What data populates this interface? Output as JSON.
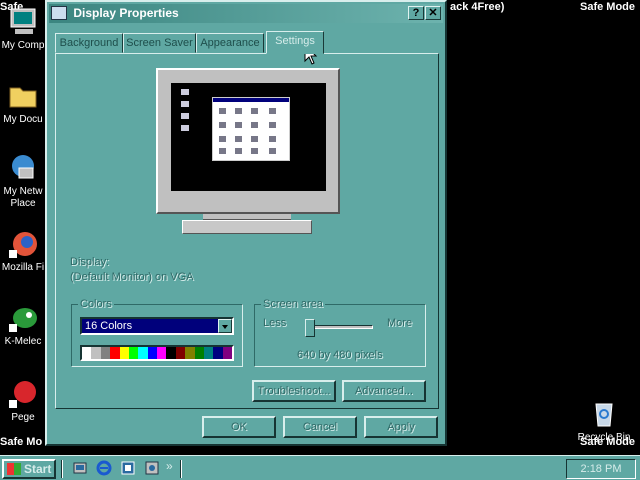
{
  "desktop": {
    "safe_mode_label": "Safe Mode",
    "safe_mode_left": "Safe",
    "header_fragment": "ack 4Free)",
    "icons": [
      {
        "label": "My Comp",
        "icon": "computer-icon"
      },
      {
        "label": "My Docu",
        "icon": "folder-icon"
      },
      {
        "label": "My Netw Place",
        "icon": "network-icon"
      },
      {
        "label": "Mozilla Fi",
        "icon": "firefox-icon"
      },
      {
        "label": "K-Melec",
        "icon": "kmeleon-icon"
      },
      {
        "label": "Pege",
        "icon": "app-icon"
      },
      {
        "label": "Safe Mo",
        "icon": ""
      },
      {
        "label": "Recycle Bin",
        "icon": "recycle-bin-icon"
      }
    ]
  },
  "dialog": {
    "title": "Display Properties",
    "help_glyph": "?",
    "close_glyph": "✕",
    "tabs": [
      {
        "label": "Background",
        "active": false
      },
      {
        "label": "Screen Saver",
        "active": false
      },
      {
        "label": "Appearance",
        "active": false
      },
      {
        "label": "Settings",
        "active": true
      }
    ],
    "display_label": "Display:",
    "display_value": "(Default Monitor) on VGA",
    "colors": {
      "group_label": "Colors",
      "selected": "16 Colors",
      "swatches": [
        "#ffffff",
        "#c0c0c0",
        "#808080",
        "#ff0000",
        "#ffff00",
        "#00ff00",
        "#00ffff",
        "#0000ff",
        "#ff00ff",
        "#000000",
        "#800000",
        "#808000",
        "#008000",
        "#008080",
        "#000080",
        "#800080"
      ]
    },
    "screen_area": {
      "group_label": "Screen area",
      "less": "Less",
      "more": "More",
      "resolution": "640 by 480 pixels",
      "level": 0
    },
    "buttons": {
      "troubleshoot": "Troubleshoot...",
      "advanced": "Advanced...",
      "ok": "OK",
      "cancel": "Cancel",
      "apply": "Apply"
    }
  },
  "taskbar": {
    "start_label": "Start",
    "quick_launch": [
      "show-desktop-icon",
      "internet-explorer-icon",
      "channels-icon",
      "media-icon"
    ],
    "chevron": "»",
    "clock": "2:18 PM"
  }
}
